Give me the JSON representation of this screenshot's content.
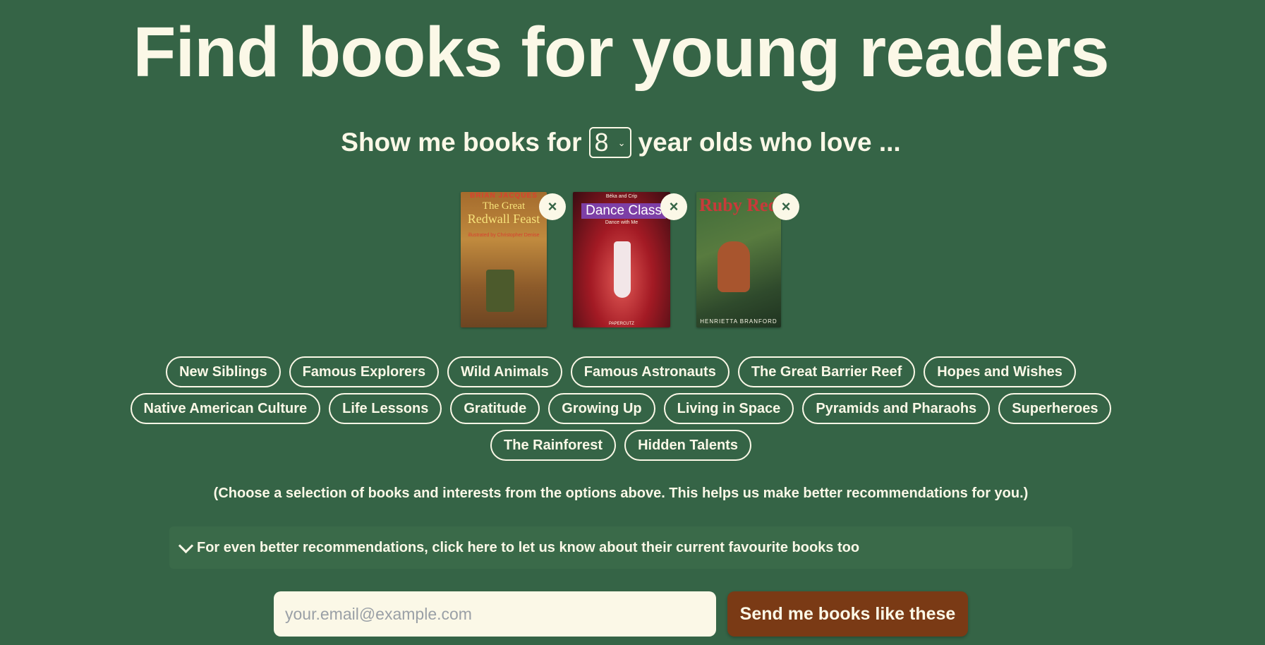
{
  "header": {
    "title": "Find books for young readers"
  },
  "prompt": {
    "before": "Show me books for",
    "age": "8",
    "after": "year old who love ..."
  },
  "selected_books": [
    {
      "cover_author": "BRIAN JACQUES",
      "cover_title_1": "The Great",
      "cover_title_2": "Redwall Feast",
      "cover_credit": "illustrated by Christopher Denise",
      "remove_label": "×"
    },
    {
      "cover_title": "Dance Class",
      "cover_top": "Béka and Crip",
      "cover_sub": "Dance with Me",
      "cover_publisher": "PAPERCUTZ",
      "remove_label": "×"
    },
    {
      "cover_title": "Ruby Red",
      "cover_author": "HENRIETTA BRANFORD",
      "remove_label": "×"
    }
  ],
  "interest_rows": [
    [
      "New Siblings",
      "Famous Explorers",
      "Wild Animals",
      "Famous Astronauts",
      "The Great Barrier Reef",
      "Hopes and Wishes"
    ],
    [
      "Native American Culture",
      "Life Lessons",
      "Gratitude",
      "Growing Up",
      "Living in Space",
      "Pyramids and Pharaohs",
      "Superheroes"
    ],
    [
      "The Rainforest",
      "Hidden Talents"
    ]
  ],
  "hint": "(Choose a selection of books and interests from the options above. This helps us make better recommendations for you.)",
  "expander": {
    "label": "For even better recommendations, click here to let us know about their current favourite books too"
  },
  "signup": {
    "email_placeholder": "your.email@example.com",
    "button_label": "Send me books like these"
  },
  "colors": {
    "background": "#356446",
    "text": "#fbf8e7",
    "button": "#7a3a15"
  }
}
